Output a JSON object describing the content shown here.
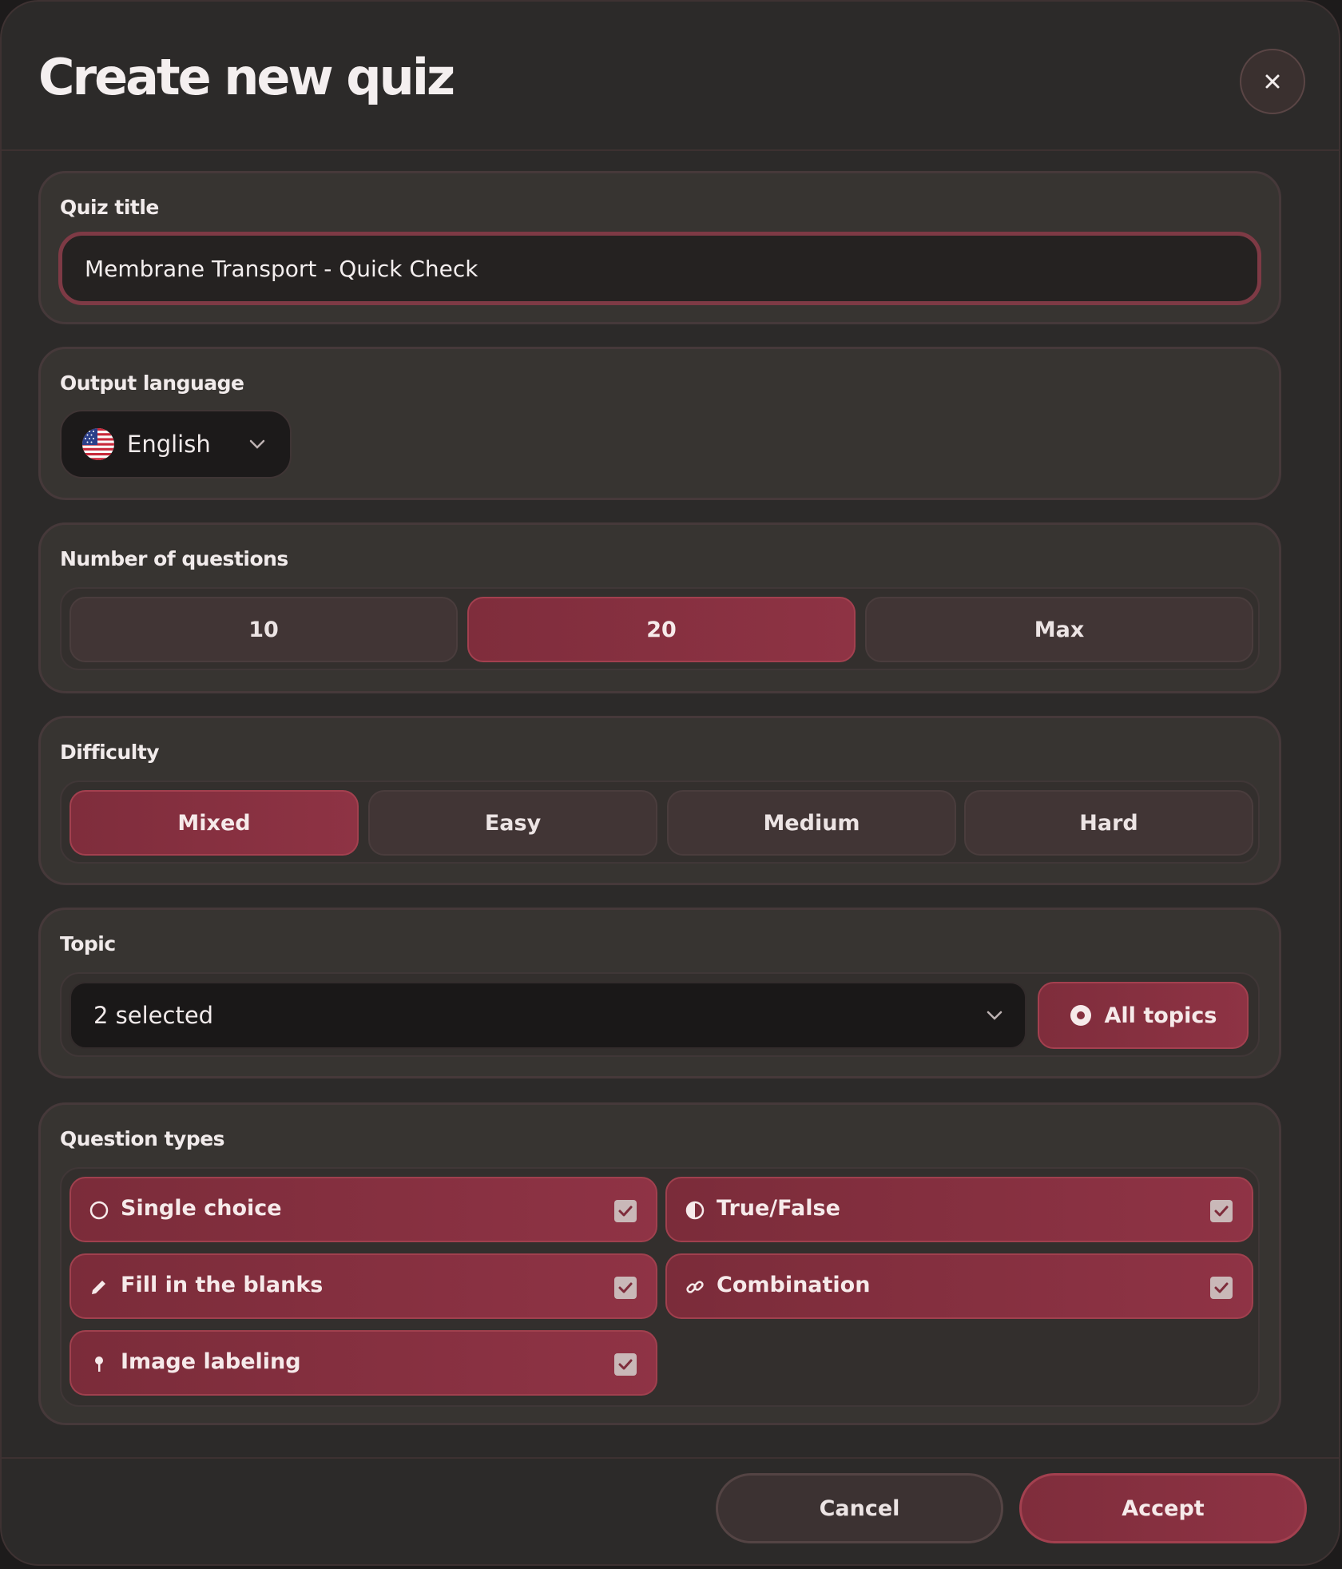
{
  "dialog": {
    "title": "Create new quiz",
    "close_icon": "close-icon"
  },
  "quiz_title": {
    "label": "Quiz title",
    "value": "Membrane Transport - Quick Check"
  },
  "output_language": {
    "label": "Output language",
    "selected": "English",
    "flag_icon": "us-flag-icon"
  },
  "num_questions": {
    "label": "Number of questions",
    "options": [
      "10",
      "20",
      "Max"
    ],
    "selected": "20"
  },
  "difficulty": {
    "label": "Difficulty",
    "options": [
      "Mixed",
      "Easy",
      "Medium",
      "Hard"
    ],
    "selected": "Mixed"
  },
  "topic": {
    "label": "Topic",
    "value": "2 selected",
    "all_topics_label": "All topics"
  },
  "question_types": {
    "label": "Question types",
    "items": [
      {
        "label": "Single choice",
        "icon": "circle-outline-icon",
        "checked": true
      },
      {
        "label": "True/False",
        "icon": "half-circle-icon",
        "checked": true
      },
      {
        "label": "Fill in the blanks",
        "icon": "pencil-icon",
        "checked": true
      },
      {
        "label": "Combination",
        "icon": "link-icon",
        "checked": true
      },
      {
        "label": "Image labeling",
        "icon": "pin-icon",
        "checked": true
      }
    ]
  },
  "footer": {
    "cancel_label": "Cancel",
    "accept_label": "Accept"
  },
  "colors": {
    "accent": "#8e3344",
    "background": "#2c2a29",
    "card": "#373431"
  }
}
